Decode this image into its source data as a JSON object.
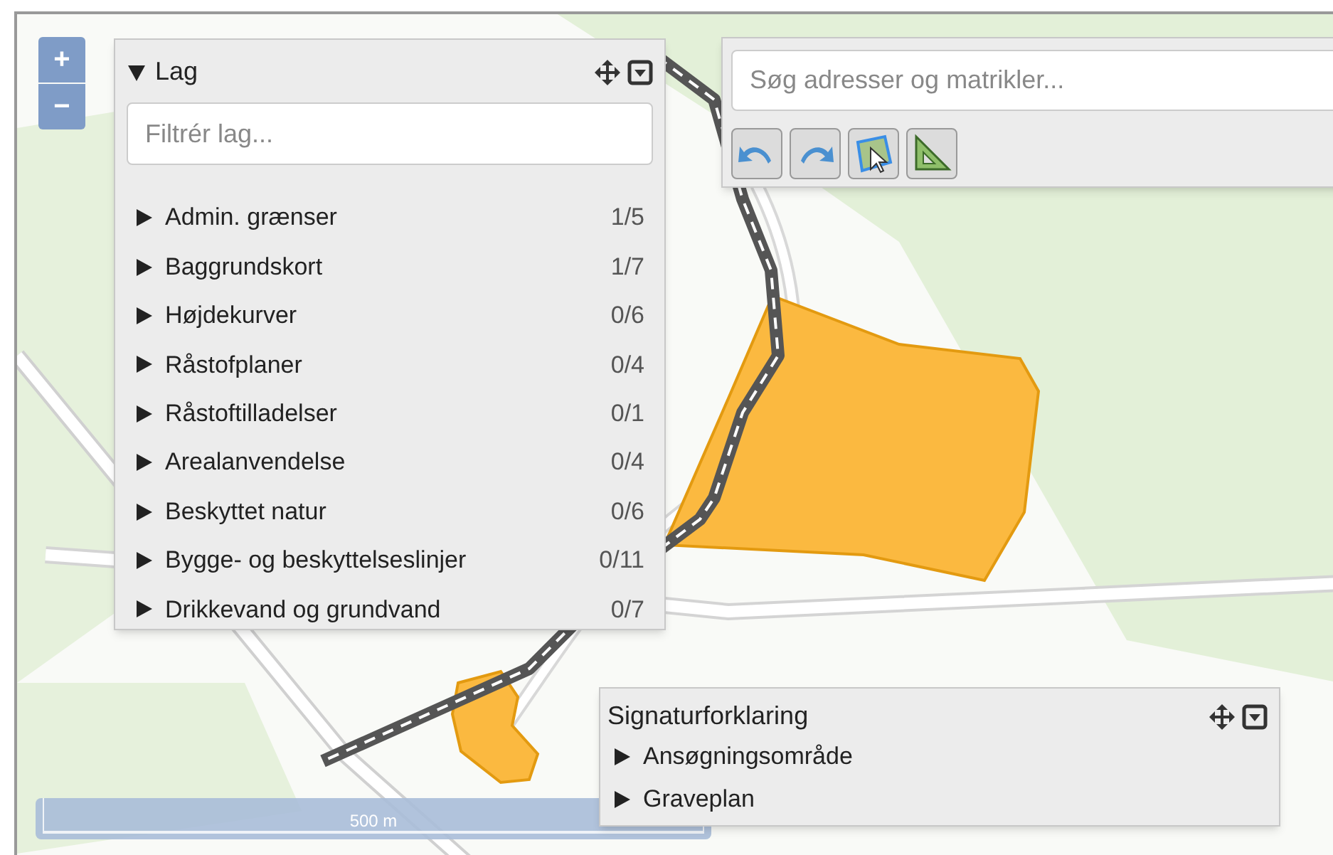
{
  "zoom_controls": [
    {
      "label": "+"
    },
    {
      "label": "−"
    }
  ],
  "layers_panel": {
    "title": "Lag",
    "expanded": true,
    "filter_placeholder": "Filtrér lag...",
    "items": [
      {
        "label": "Admin. grænser",
        "count": "1/5",
        "expanded": false
      },
      {
        "label": "Baggrundskort",
        "count": "1/7",
        "expanded": false
      },
      {
        "label": "Højdekurver",
        "count": "0/6",
        "expanded": false
      },
      {
        "label": "Råstofplaner",
        "count": "0/4",
        "expanded": false
      },
      {
        "label": "Råstoftilladelser",
        "count": "0/1",
        "expanded": false
      },
      {
        "label": "Arealanvendelse",
        "count": "0/4",
        "expanded": false
      },
      {
        "label": "Beskyttet natur",
        "count": "0/6",
        "expanded": false
      },
      {
        "label": "Bygge- og beskyttelseslinjer",
        "count": "0/11",
        "expanded": false
      },
      {
        "label": "Drikkevand og grundvand",
        "count": "0/7",
        "expanded": false
      }
    ]
  },
  "search_panel": {
    "placeholder": "Søg adresser og matrikler...",
    "tools": [
      {
        "kind": "undo"
      },
      {
        "kind": "redo"
      },
      {
        "kind": "select"
      },
      {
        "kind": "measure"
      }
    ]
  },
  "legend": {
    "title": "Signaturforklaring",
    "items": [
      {
        "label": "Ansøgningsområde",
        "expanded": false
      },
      {
        "label": "Graveplan",
        "expanded": false
      }
    ]
  },
  "scale_bar": {
    "label": "500 m"
  }
}
